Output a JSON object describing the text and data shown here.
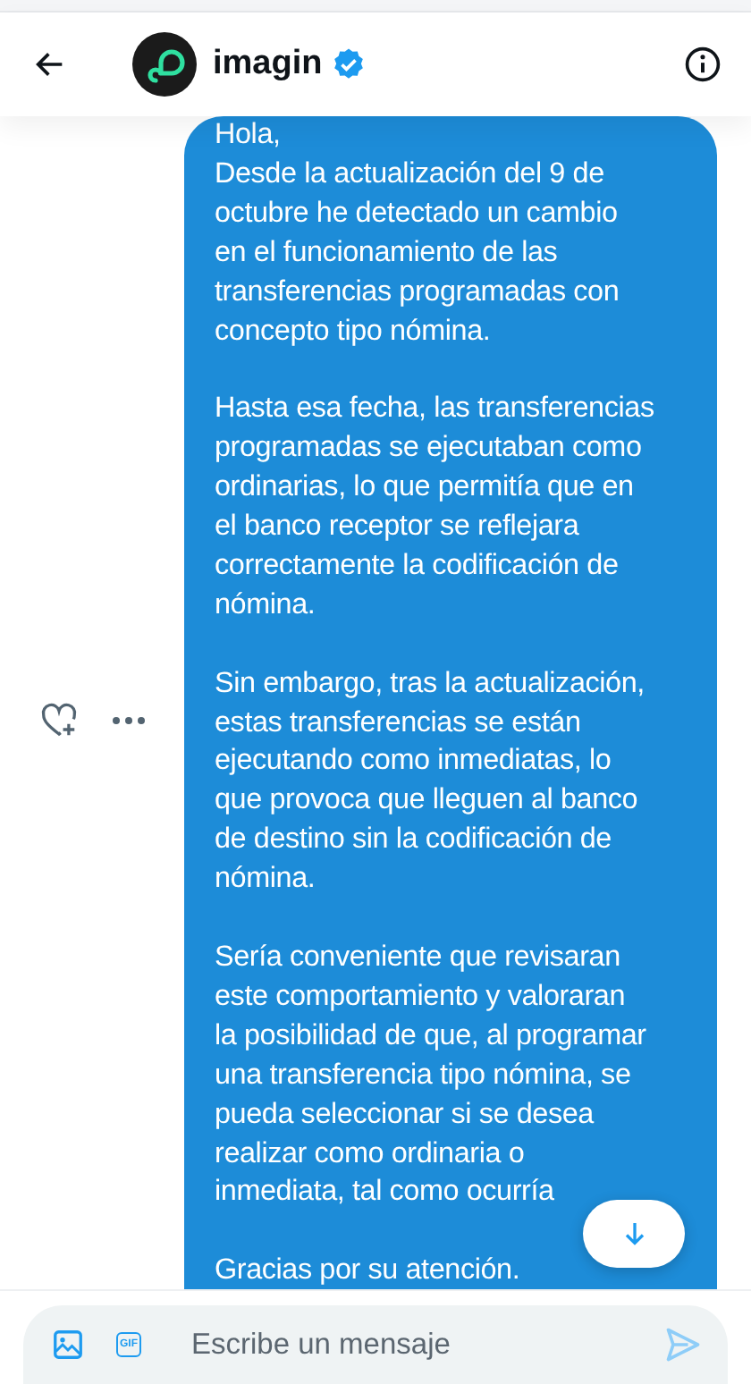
{
  "header": {
    "title": "imagin"
  },
  "message": {
    "paragraphs": [
      {
        "lines": [
          "Hola,",
          "Desde la actualización del 9 de",
          "octubre he detectado un cambio",
          "en el funcionamiento de las",
          "transferencias programadas con",
          "concepto tipo nómina."
        ]
      },
      {
        "lines": [
          "Hasta esa fecha, las transferencias",
          "programadas se ejecutaban como",
          "ordinarias, lo que permitía que en",
          "el banco receptor se reflejara",
          "correctamente la codificación de",
          "nómina."
        ]
      },
      {
        "lines": [
          "Sin embargo, tras la actualización,",
          "estas transferencias se están",
          "ejecutando como inmediatas, lo",
          "que provoca que lleguen al banco",
          "de destino sin la codificación de",
          "nómina."
        ]
      },
      {
        "lines": [
          "Sería conveniente que revisaran",
          "este comportamiento y valoraran",
          "la posibilidad de que, al programar",
          "una transferencia tipo nómina, se",
          "pueda seleccionar si se desea",
          "realizar como ordinaria o",
          "inmediata, tal como ocurría"
        ]
      },
      {
        "lines": [
          "Gracias por su atención."
        ]
      }
    ]
  },
  "composer": {
    "gif_label": "GIF",
    "placeholder": "Escribe un mensaje"
  }
}
